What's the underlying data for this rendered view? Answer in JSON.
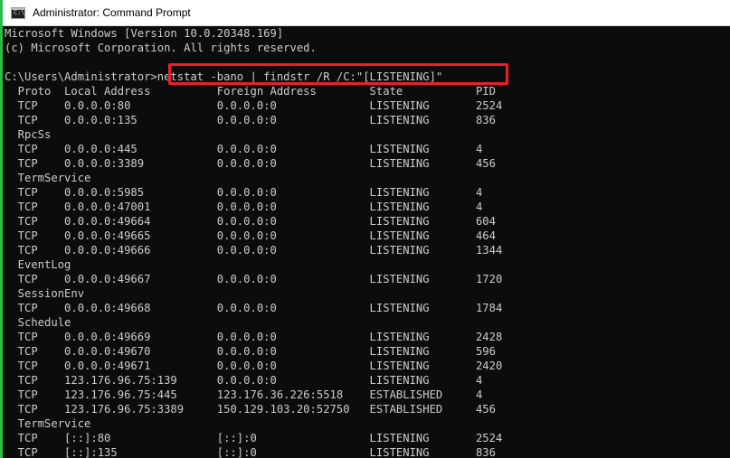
{
  "window": {
    "title": "Administrator: Command Prompt",
    "icon": "cmd-icon",
    "icon_glyph": "C:\\"
  },
  "console": {
    "lines": [
      "Microsoft Windows [Version 10.0.20348.169]",
      "(c) Microsoft Corporation. All rights reserved.",
      "",
      "C:\\Users\\Administrator>netstat -bano | findstr /R /C:\"[LISTENING]\"",
      "  Proto  Local Address          Foreign Address        State           PID",
      "  TCP    0.0.0.0:80             0.0.0.0:0              LISTENING       2524",
      "  TCP    0.0.0.0:135            0.0.0.0:0              LISTENING       836",
      "  RpcSs",
      "  TCP    0.0.0.0:445            0.0.0.0:0              LISTENING       4",
      "  TCP    0.0.0.0:3389           0.0.0.0:0              LISTENING       456",
      "  TermService",
      "  TCP    0.0.0.0:5985           0.0.0.0:0              LISTENING       4",
      "  TCP    0.0.0.0:47001          0.0.0.0:0              LISTENING       4",
      "  TCP    0.0.0.0:49664          0.0.0.0:0              LISTENING       604",
      "  TCP    0.0.0.0:49665          0.0.0.0:0              LISTENING       464",
      "  TCP    0.0.0.0:49666          0.0.0.0:0              LISTENING       1344",
      "  EventLog",
      "  TCP    0.0.0.0:49667          0.0.0.0:0              LISTENING       1720",
      "  SessionEnv",
      "  TCP    0.0.0.0:49668          0.0.0.0:0              LISTENING       1784",
      "  Schedule",
      "  TCP    0.0.0.0:49669          0.0.0.0:0              LISTENING       2428",
      "  TCP    0.0.0.0:49670          0.0.0.0:0              LISTENING       596",
      "  TCP    0.0.0.0:49671          0.0.0.0:0              LISTENING       2420",
      "  TCP    123.176.96.75:139      0.0.0.0:0              LISTENING       4",
      "  TCP    123.176.96.75:445      123.176.36.226:5518    ESTABLISHED     4",
      "  TCP    123.176.96.75:3389     150.129.103.20:52750   ESTABLISHED     456",
      "  TermService",
      "  TCP    [::]:80                [::]:0                 LISTENING       2524",
      "  TCP    [::]:135               [::]:0                 LISTENING       836"
    ]
  },
  "colors": {
    "console_bg": "#0c0c0c",
    "console_text": "#cccccc",
    "highlight": "#e8212b",
    "accent": "#2bbd4a"
  }
}
